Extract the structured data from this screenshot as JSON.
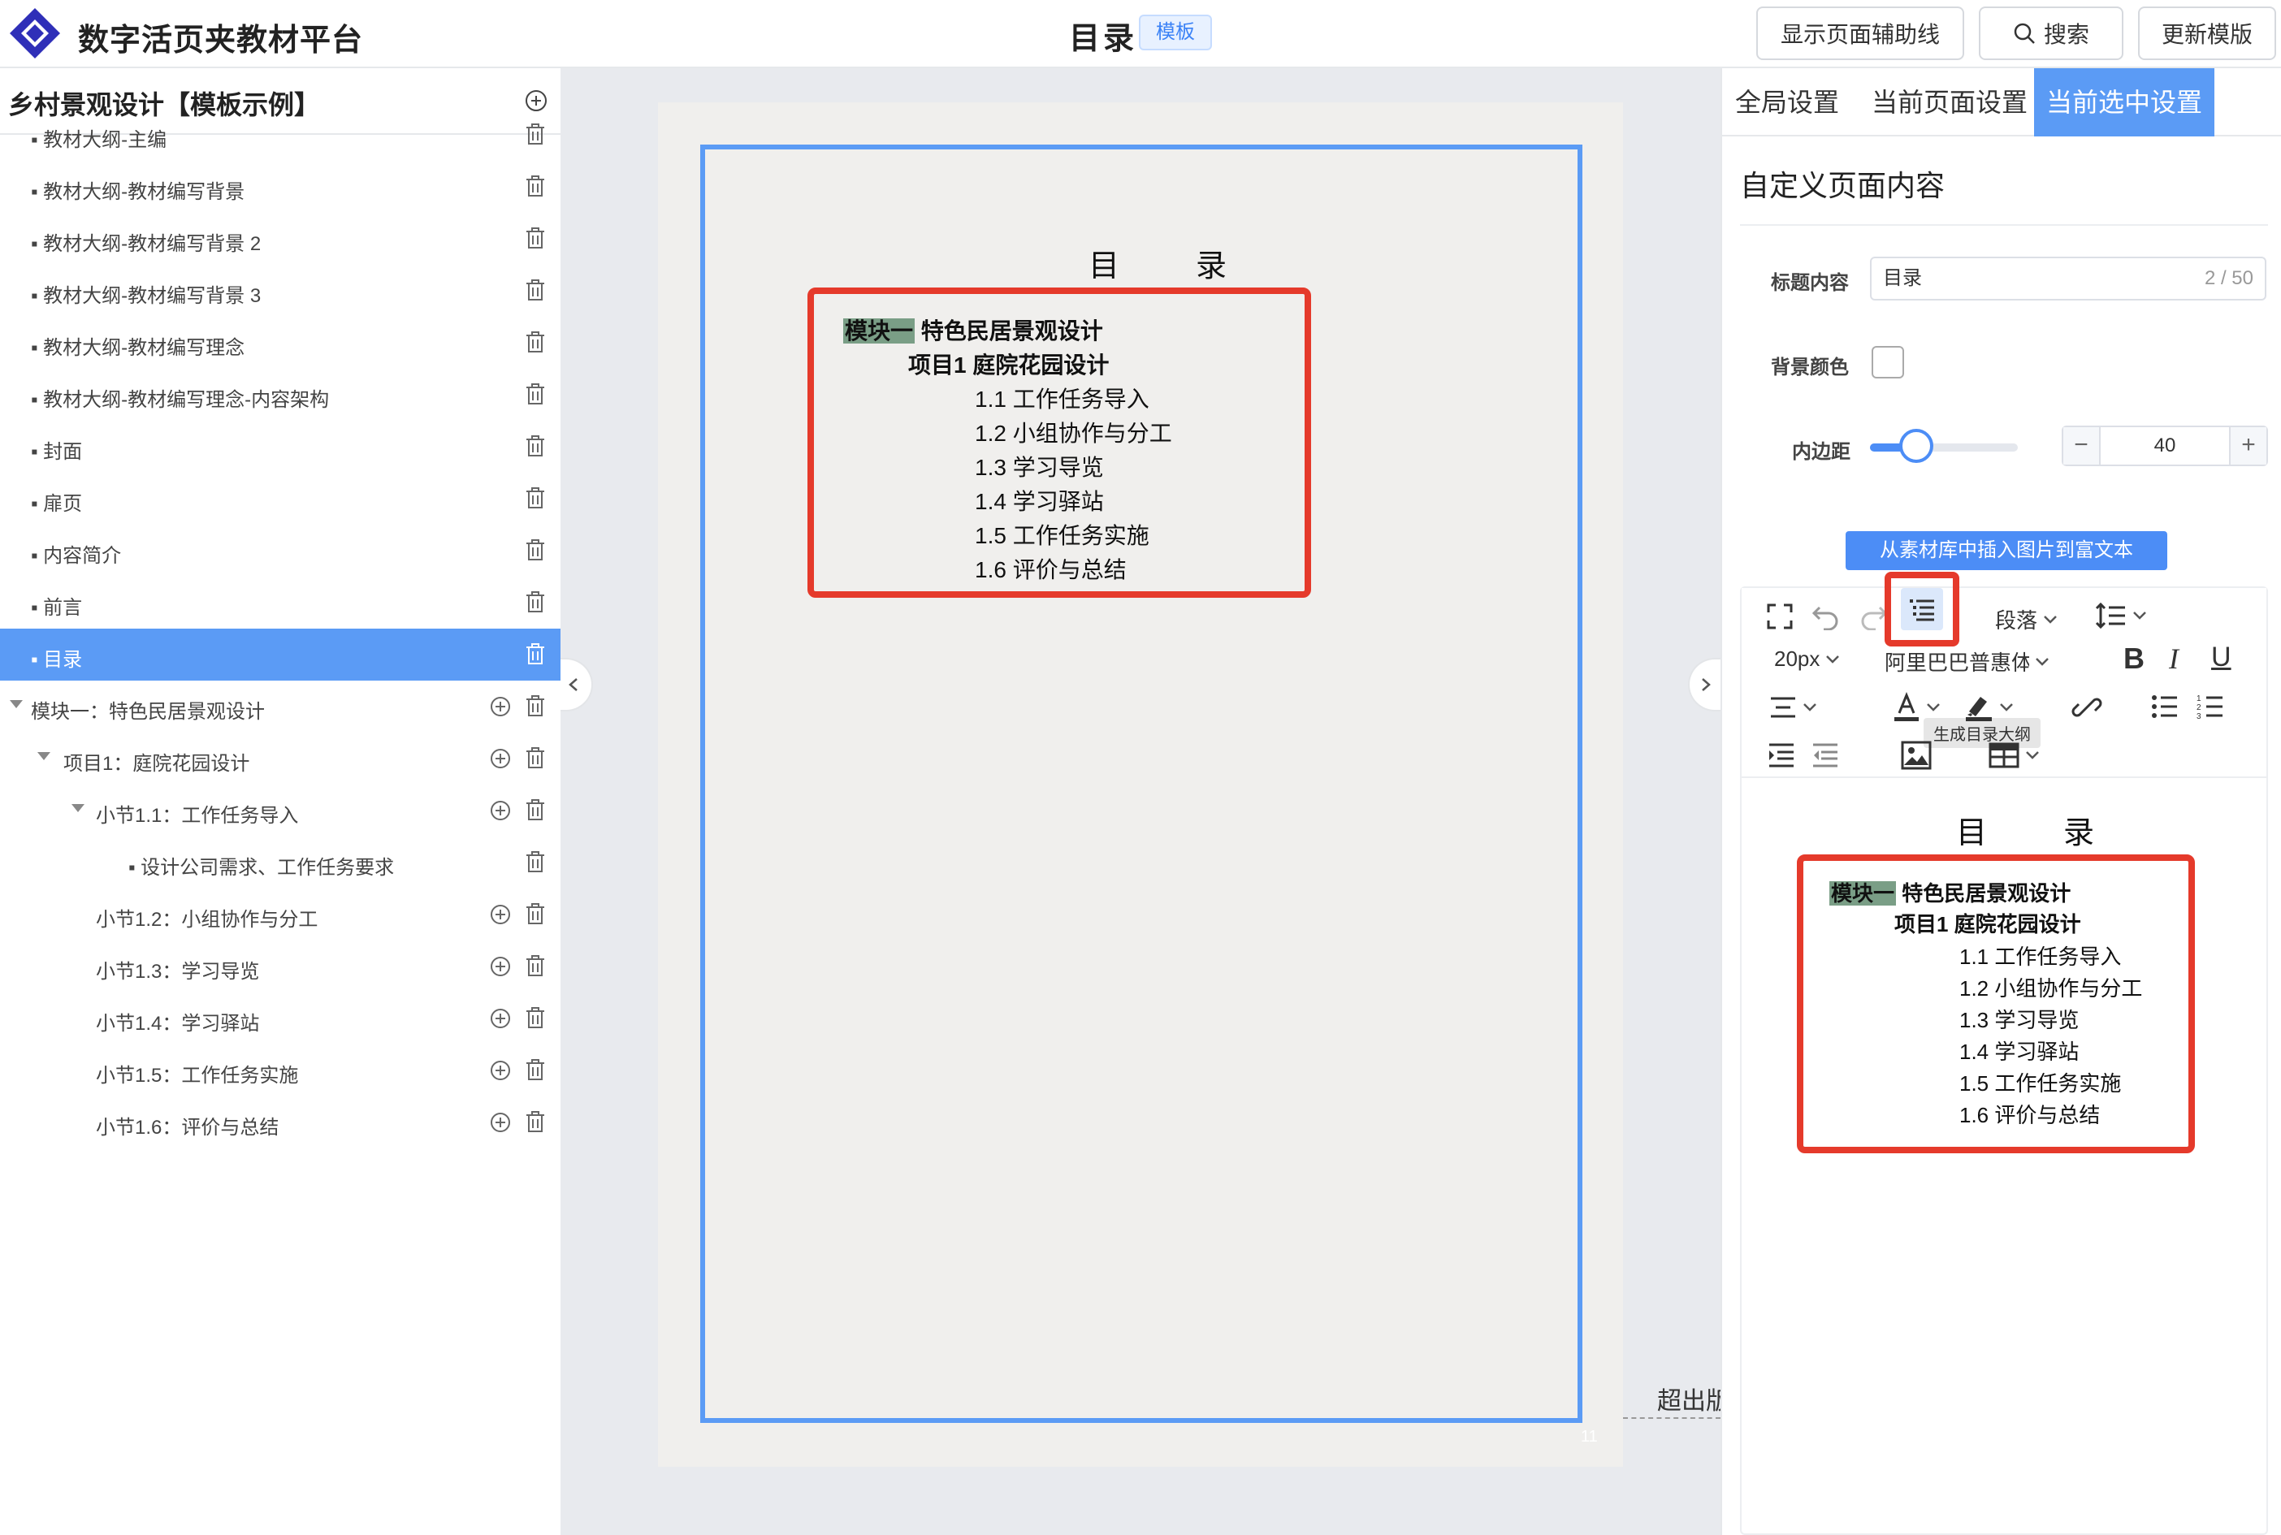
{
  "header": {
    "app_title": "数字活页夹教材平台",
    "page_title": "目录",
    "template_badge": "模板",
    "buttons": {
      "guides": "显示页面辅助线",
      "search": "搜索",
      "update": "更新模版"
    }
  },
  "sidebar": {
    "book_title": "乡村景观设计【模板示例】",
    "items": [
      {
        "label": "▪ 教材大纲-主编"
      },
      {
        "label": "▪ 教材大纲-教材编写背景"
      },
      {
        "label": "▪ 教材大纲-教材编写背景 2"
      },
      {
        "label": "▪ 教材大纲-教材编写背景 3"
      },
      {
        "label": "▪ 教材大纲-教材编写理念"
      },
      {
        "label": "▪ 教材大纲-教材编写理念-内容架构"
      },
      {
        "label": "▪ 封面"
      },
      {
        "label": "▪ 扉页"
      },
      {
        "label": "▪ 内容简介"
      },
      {
        "label": "▪ 前言"
      },
      {
        "label": "▪ 目录"
      },
      {
        "label": "模块一：特色民居景观设计"
      },
      {
        "label": "项目1：庭院花园设计"
      },
      {
        "label": "小节1.1：工作任务导入"
      },
      {
        "label": "▪ 设计公司需求、工作任务要求"
      },
      {
        "label": "小节1.2：小组协作与分工"
      },
      {
        "label": "小节1.3：学习导览"
      },
      {
        "label": "小节1.4：学习驿站"
      },
      {
        "label": "小节1.5：工作任务实施"
      },
      {
        "label": "小节1.6：评价与总结"
      }
    ]
  },
  "canvas": {
    "title": "目　录",
    "module_tag": "模块一",
    "module_rest": " 特色民居景观设计",
    "project": "项目1 庭院花园设计",
    "sections": [
      "1.1 工作任务导入",
      "1.2 小组协作与分工",
      "1.3 学习导览",
      "1.4 学习驿站",
      "1.5 工作任务实施",
      "1.6 评价与总结"
    ],
    "overflow_label": "超出版",
    "page_number": "11"
  },
  "panel": {
    "tabs": [
      "全局设置",
      "当前页面设置",
      "当前选中设置"
    ],
    "section_title": "自定义页面内容",
    "title_label": "标题内容",
    "title_value": "目录",
    "title_count": "2 / 50",
    "bg_label": "背景颜色",
    "padding_label": "内边距",
    "padding_value": "40",
    "padding_fraction": 0.4,
    "insert_btn": "从素材库中插入图片到富文本",
    "toolbar": {
      "paragraph": "段落",
      "font_size": "20px",
      "font_family": "阿里巴巴普惠体",
      "tooltip": "生成目录大纲"
    }
  },
  "colors": {
    "accent": "#5b9bf5",
    "highlight_border": "#e53a2b",
    "module_tag_bg": "#7a9e86"
  }
}
